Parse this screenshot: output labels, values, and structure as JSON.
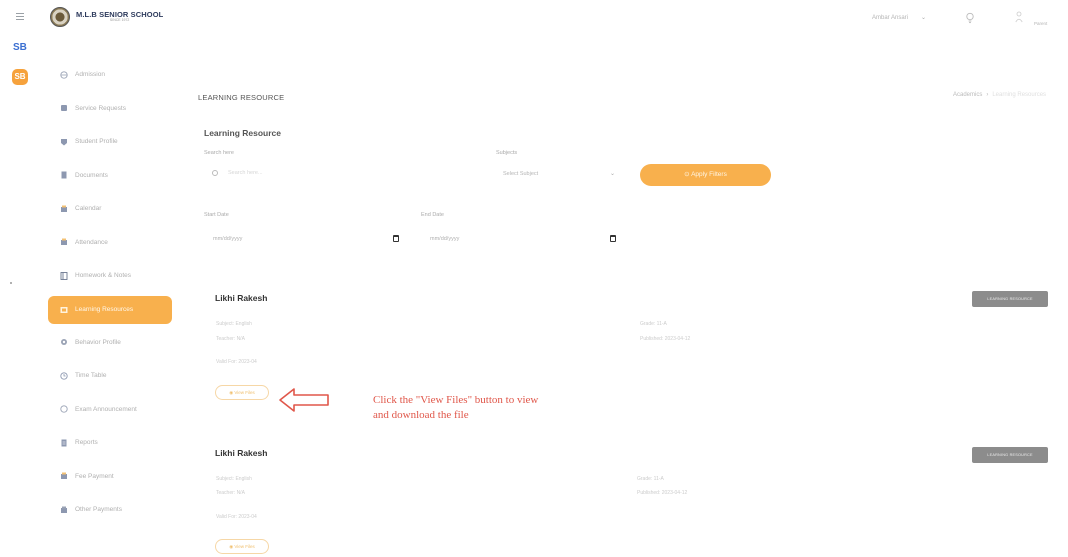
{
  "header": {
    "school_name": "M.L.B SENIOR SCHOOL",
    "school_sub": "SINCE 1972",
    "user_name": "Ambar Ansari",
    "caret": "⌄",
    "user_label": "Parent"
  },
  "rail": {
    "item1": "SB",
    "item2": "SB"
  },
  "sidebar": {
    "items": [
      {
        "label": "Admission",
        "icon": "admission-icon"
      },
      {
        "label": "Service Requests",
        "icon": "service-requests-icon"
      },
      {
        "label": "Student Profile",
        "icon": "student-profile-icon"
      },
      {
        "label": "Documents",
        "icon": "documents-icon"
      },
      {
        "label": "Calendar",
        "icon": "calendar-icon"
      },
      {
        "label": "Attendance",
        "icon": "attendance-icon"
      },
      {
        "label": "Homework & Notes",
        "icon": "homework-icon"
      },
      {
        "label": "Learning Resources",
        "icon": "learning-resources-icon",
        "active": true
      },
      {
        "label": "Behavior Profile",
        "icon": "behavior-profile-icon"
      },
      {
        "label": "Time Table",
        "icon": "clock-icon"
      },
      {
        "label": "Exam Announcement",
        "icon": "exam-icon"
      },
      {
        "label": "Reports",
        "icon": "reports-icon"
      },
      {
        "label": "Fee Payment",
        "icon": "fee-payment-icon"
      },
      {
        "label": "Other Payments",
        "icon": "other-payments-icon"
      }
    ]
  },
  "page": {
    "title": "LEARNING RESOURCE",
    "breadcrumb": {
      "parent": "Academics",
      "separator": "›",
      "current": "Learning Resources"
    },
    "card_title": "Learning Resource"
  },
  "filters": {
    "search_label": "Search here",
    "search_placeholder": "Search here...",
    "subjects_label": "Subjects",
    "subjects_value": "Select Subject",
    "subjects_caret": "⌄",
    "apply_label": "Apply Filters",
    "start_label": "Start Date",
    "end_label": "End Date",
    "date_placeholder": "mm/dd/yyyy"
  },
  "results": [
    {
      "name": "Likhi Rakesh",
      "badge": "LEARNING RESOURCE",
      "subject": "Subject: English",
      "teacher": "Teacher: N/A",
      "valid_for": "Valid For: 2023-04",
      "grade": "Grade: 11-A",
      "published": "Published: 2023-04-12",
      "view_files": "View Files"
    },
    {
      "name": "Likhi Rakesh",
      "badge": "LEARNING RESOURCE",
      "subject": "Subject: English",
      "teacher": "Teacher: N/A",
      "valid_for": "Valid For: 2023-04",
      "grade": "Grade: 11-A",
      "published": "Published: 2023-04-12",
      "view_files": "View Files"
    }
  ],
  "annotation": {
    "line1": "Click the \"View Files\" button to view",
    "line2": "and download the file",
    "color": "#e0574a"
  },
  "colors": {
    "accent": "#f8b04d",
    "badge": "#8c8c8c",
    "brand": "#2d3a5c"
  }
}
